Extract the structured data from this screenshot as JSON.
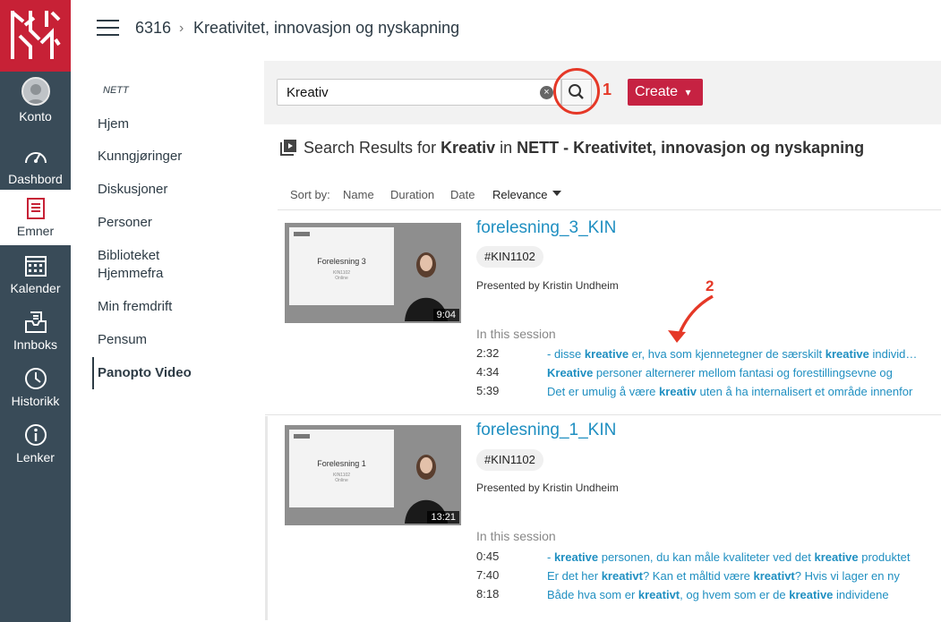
{
  "nav": {
    "items": [
      {
        "label": "Konto",
        "icon": "account-avatar-icon"
      },
      {
        "label": "Dashbord",
        "icon": "dashboard-gauge-icon"
      },
      {
        "label": "Emner",
        "icon": "courses-book-icon"
      },
      {
        "label": "Kalender",
        "icon": "calendar-icon"
      },
      {
        "label": "Innboks",
        "icon": "inbox-icon"
      },
      {
        "label": "Historikk",
        "icon": "history-clock-icon"
      },
      {
        "label": "Lenker",
        "icon": "info-circle-icon"
      }
    ],
    "active_index": 2,
    "brand_color": "#c72136",
    "bg_color": "#394b58"
  },
  "header": {
    "course_code": "6316",
    "separator": "›",
    "course_name": "Kreativitet, innovasjon og nyskapning"
  },
  "course_nav": {
    "label": "NETT",
    "items": [
      "Hjem",
      "Kunngjøringer",
      "Diskusjoner",
      "Personer",
      "Biblioteket Hjemmefra",
      "Min fremdrift",
      "Pensum",
      "Panopto Video"
    ],
    "active": "Panopto Video"
  },
  "toolbar": {
    "search_value": "Kreativ",
    "annotation_1": "1",
    "annotation_2": "2",
    "create_label": "Create",
    "create_caret": "▾",
    "create_color": "#c62242",
    "annotation_color": "#e53827"
  },
  "results_header": {
    "prefix": "Search Results for ",
    "query": "Kreativ",
    "in_text": " in ",
    "folder": "NETT - Kreativitet, innovasjon og nyskapning"
  },
  "sort": {
    "label": "Sort by:",
    "options": [
      "Name",
      "Duration",
      "Date",
      "Relevance"
    ],
    "active": "Relevance"
  },
  "results": [
    {
      "title": "forelesning_3_KIN",
      "tag": "#KIN1102",
      "presented_by": "Presented by Kristin Undheim",
      "duration": "9:04",
      "slide_title": "Forelesning 3",
      "slide_sub1": "KIN1102",
      "slide_sub2": "Online",
      "in_session": "In this session",
      "hits": [
        {
          "time": "2:32",
          "parts": [
            [
              "- disse ",
              false
            ],
            [
              "kreative",
              true
            ],
            [
              " er, hva som kjennetegner de særskilt ",
              false
            ],
            [
              "kreative",
              true
            ],
            [
              " individene",
              false
            ]
          ]
        },
        {
          "time": "4:34",
          "parts": [
            [
              "Kreative",
              true
            ],
            [
              " personer alternerer mellom fantasi og forestillingsevne og",
              false
            ]
          ]
        },
        {
          "time": "5:39",
          "parts": [
            [
              "Det er umulig å være ",
              false
            ],
            [
              "kreativ",
              true
            ],
            [
              " uten å ha internalisert et område innenfor",
              false
            ]
          ]
        }
      ]
    },
    {
      "title": "forelesning_1_KIN",
      "tag": "#KIN1102",
      "presented_by": "Presented by Kristin Undheim",
      "duration": "13:21",
      "slide_title": "Forelesning 1",
      "slide_sub1": "KIN1102",
      "slide_sub2": "Online",
      "in_session": "In this session",
      "hits": [
        {
          "time": "0:45",
          "parts": [
            [
              "- ",
              false
            ],
            [
              "kreative",
              true
            ],
            [
              " personen, du kan måle kvaliteter ved det ",
              false
            ],
            [
              "kreative",
              true
            ],
            [
              " produktet",
              false
            ]
          ]
        },
        {
          "time": "7:40",
          "parts": [
            [
              "Er det her ",
              false
            ],
            [
              "kreativt",
              true
            ],
            [
              "? Kan et måltid være ",
              false
            ],
            [
              "kreativt",
              true
            ],
            [
              "? Hvis vi lager en ny",
              false
            ]
          ]
        },
        {
          "time": "8:18",
          "parts": [
            [
              "Både hva som er ",
              false
            ],
            [
              "kreativt",
              true
            ],
            [
              ", og hvem som er de ",
              false
            ],
            [
              "kreative",
              true
            ],
            [
              " individene",
              false
            ]
          ]
        }
      ]
    }
  ]
}
